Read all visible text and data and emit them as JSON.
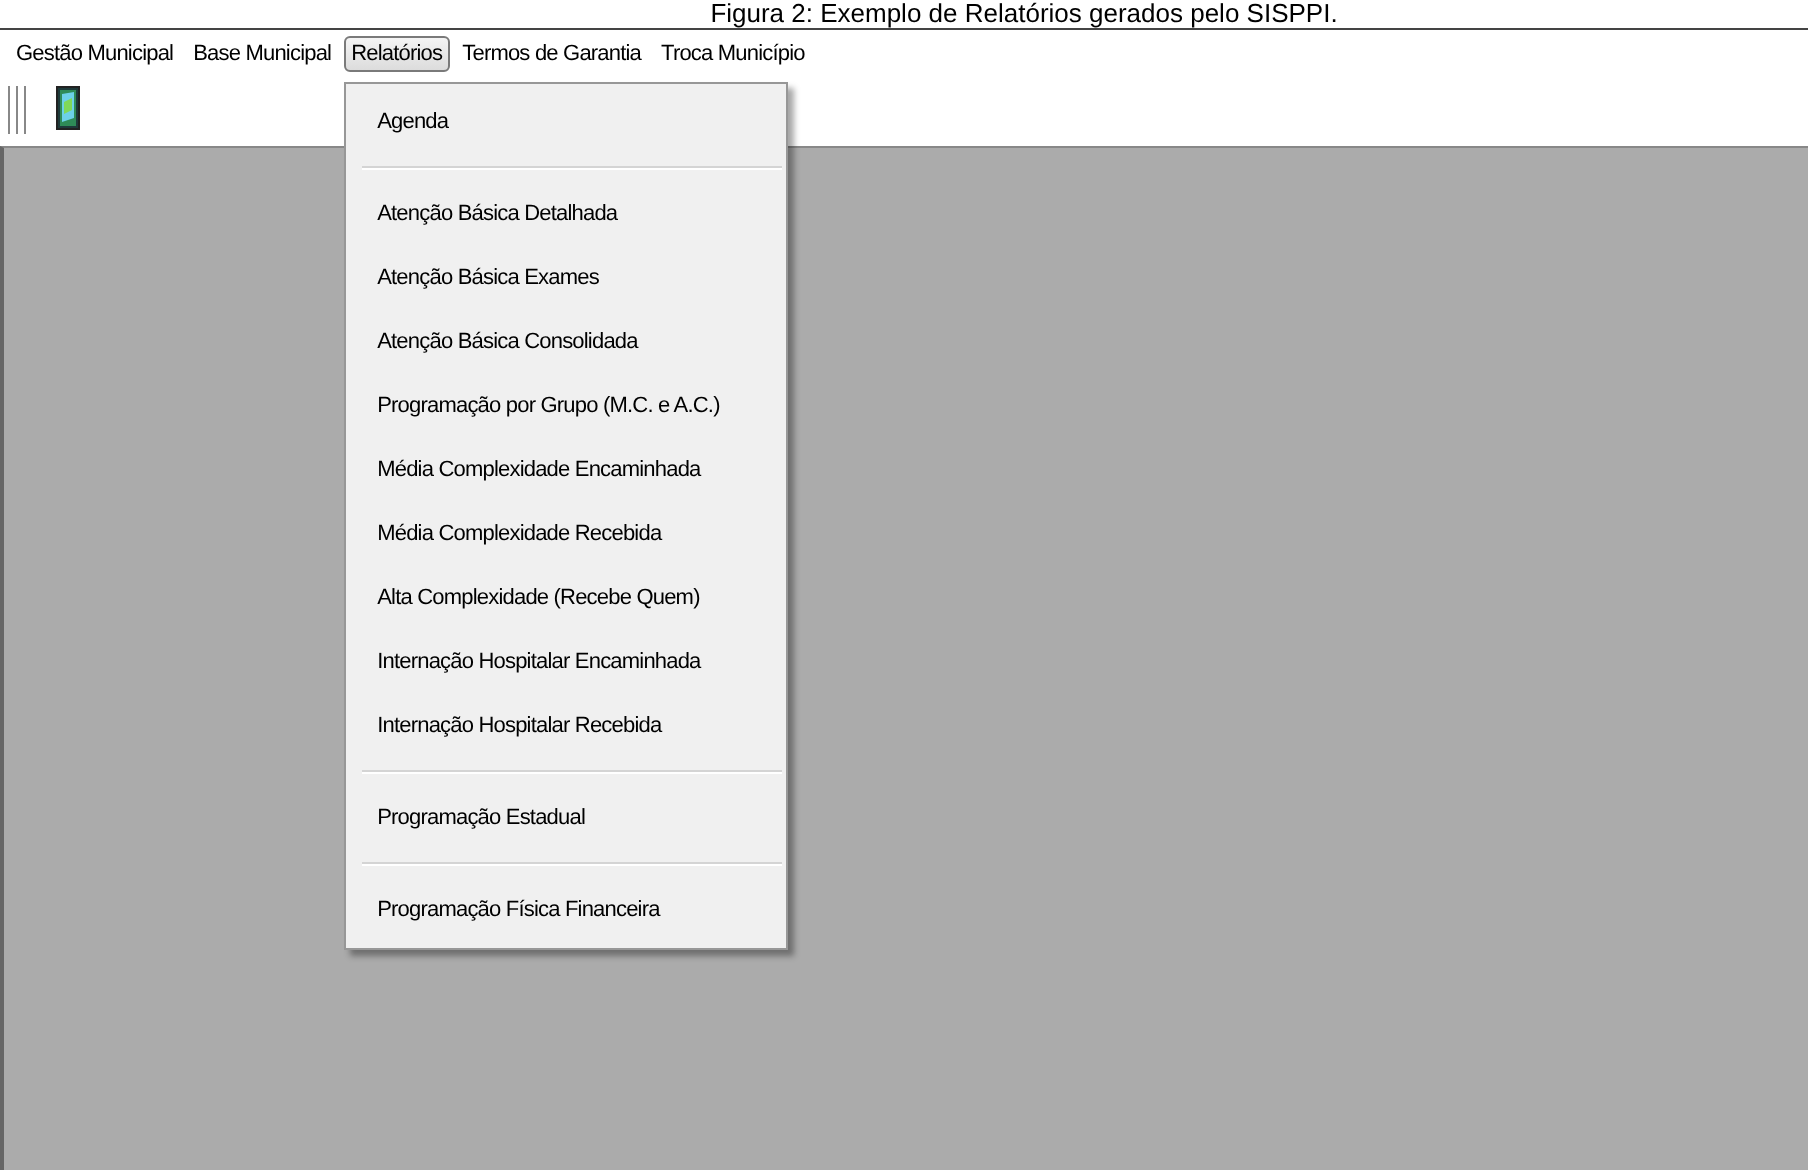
{
  "caption": "Figura 2: Exemplo de Relatórios gerados pelo SISPPI.",
  "menu_bar": [
    {
      "label": "Gestão Municipal",
      "selected": false
    },
    {
      "label": "Base Municipal",
      "selected": false
    },
    {
      "label": "Relatórios",
      "selected": true
    },
    {
      "label": "Termos de Garantia",
      "selected": false
    },
    {
      "label": "Troca Município",
      "selected": false
    }
  ],
  "dropdown": [
    {
      "kind": "item",
      "label": "Agenda"
    },
    {
      "kind": "separator"
    },
    {
      "kind": "item",
      "label": "Atenção Básica Detalhada"
    },
    {
      "kind": "item",
      "label": "Atenção Básica Exames"
    },
    {
      "kind": "item",
      "label": "Atenção Básica Consolidada"
    },
    {
      "kind": "item",
      "label": "Programação por Grupo (M.C. e A.C.)"
    },
    {
      "kind": "item",
      "label": "Média Complexidade Encaminhada"
    },
    {
      "kind": "item",
      "label": "Média Complexidade Recebida"
    },
    {
      "kind": "item",
      "label": "Alta Complexidade (Recebe Quem)"
    },
    {
      "kind": "item",
      "label": "Internação Hospitalar Encaminhada"
    },
    {
      "kind": "item",
      "label": "Internação Hospitalar Recebida"
    },
    {
      "kind": "separator"
    },
    {
      "kind": "item",
      "label": "Programação Estadual"
    },
    {
      "kind": "separator"
    },
    {
      "kind": "item",
      "label": "Programação Física Financeira"
    }
  ]
}
